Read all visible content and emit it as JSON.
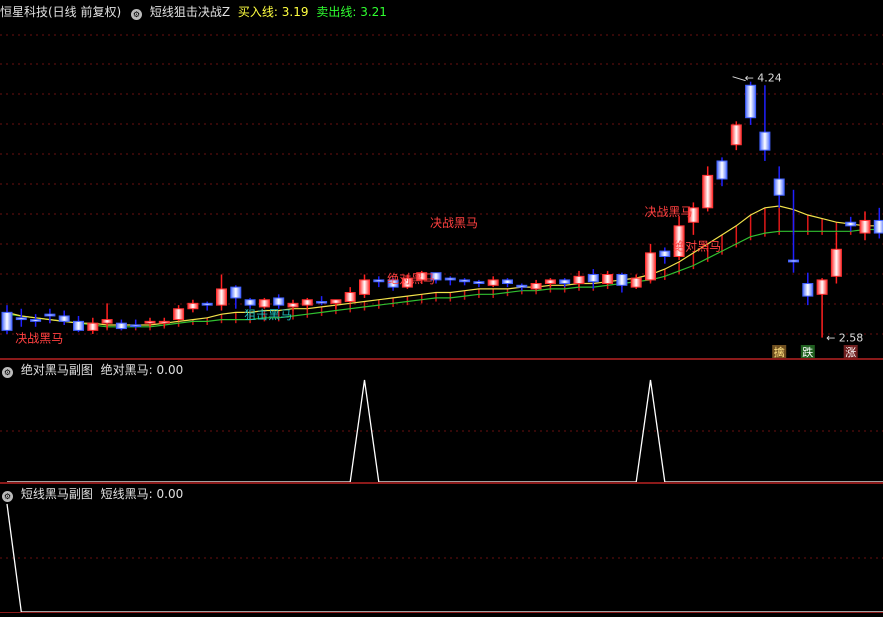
{
  "main_header": {
    "stock_name": "恒星科技(日线 前复权)",
    "indicator": "短线狙击决战Z",
    "buy_label": "买入线:",
    "buy_value": "3.19",
    "sell_label": "卖出线:",
    "sell_value": "3.21",
    "colors": {
      "buy": "#ffff40",
      "sell": "#30ff30"
    }
  },
  "sub1_header": {
    "title": "绝对黑马副图",
    "series_label": "绝对黑马:",
    "series_value": "0.00"
  },
  "sub2_header": {
    "title": "短线黑马副图",
    "series_label": "短线黑马:",
    "series_value": "0.00"
  },
  "icons": [
    "gear-icon"
  ],
  "chart_data": [
    {
      "type": "candlestick",
      "price_range": [
        2.5,
        4.32
      ],
      "high_label": "4.24",
      "low_label": "2.58",
      "candles": [
        [
          2.72,
          2.62,
          2.6,
          2.76,
          "down"
        ],
        [
          2.68,
          2.69,
          2.64,
          2.74,
          "down"
        ],
        [
          2.68,
          2.67,
          2.64,
          2.71,
          "down"
        ],
        [
          2.7,
          2.71,
          2.66,
          2.74,
          "down"
        ],
        [
          2.7,
          2.67,
          2.65,
          2.73,
          "down"
        ],
        [
          2.67,
          2.62,
          2.61,
          2.7,
          "down"
        ],
        [
          2.62,
          2.66,
          2.6,
          2.69,
          "up"
        ],
        [
          2.68,
          2.66,
          2.63,
          2.77,
          "up"
        ],
        [
          2.66,
          2.63,
          2.62,
          2.68,
          "down"
        ],
        [
          2.65,
          2.65,
          2.63,
          2.68,
          "down"
        ],
        [
          2.66,
          2.67,
          2.64,
          2.69,
          "up"
        ],
        [
          2.66,
          2.67,
          2.64,
          2.69,
          "up"
        ],
        [
          2.68,
          2.74,
          2.67,
          2.76,
          "up"
        ],
        [
          2.74,
          2.77,
          2.72,
          2.79,
          "up"
        ],
        [
          2.77,
          2.76,
          2.73,
          2.78,
          "down"
        ],
        [
          2.76,
          2.85,
          2.73,
          2.93,
          "up"
        ],
        [
          2.86,
          2.8,
          2.74,
          2.87,
          "down"
        ],
        [
          2.79,
          2.76,
          2.74,
          2.8,
          "down"
        ],
        [
          2.75,
          2.79,
          2.74,
          2.8,
          "up"
        ],
        [
          2.8,
          2.76,
          2.74,
          2.82,
          "down"
        ],
        [
          2.75,
          2.77,
          2.73,
          2.79,
          "up"
        ],
        [
          2.76,
          2.79,
          2.74,
          2.8,
          "up"
        ],
        [
          2.78,
          2.78,
          2.76,
          2.81,
          "down"
        ],
        [
          2.77,
          2.79,
          2.74,
          2.79,
          "up"
        ],
        [
          2.78,
          2.83,
          2.77,
          2.86,
          "up"
        ],
        [
          2.82,
          2.9,
          2.8,
          2.93,
          "up"
        ],
        [
          2.9,
          2.89,
          2.86,
          2.92,
          "down"
        ],
        [
          2.9,
          2.86,
          2.84,
          2.91,
          "down"
        ],
        [
          2.86,
          2.91,
          2.85,
          2.93,
          "up"
        ],
        [
          2.9,
          2.94,
          2.88,
          2.95,
          "up"
        ],
        [
          2.94,
          2.9,
          2.88,
          2.94,
          "down"
        ],
        [
          2.91,
          2.9,
          2.87,
          2.92,
          "down"
        ],
        [
          2.9,
          2.89,
          2.87,
          2.91,
          "down"
        ],
        [
          2.89,
          2.88,
          2.86,
          2.9,
          "down"
        ],
        [
          2.87,
          2.9,
          2.86,
          2.92,
          "up"
        ],
        [
          2.9,
          2.88,
          2.86,
          2.91,
          "down"
        ],
        [
          2.87,
          2.86,
          2.84,
          2.88,
          "down"
        ],
        [
          2.85,
          2.88,
          2.84,
          2.9,
          "up"
        ],
        [
          2.88,
          2.9,
          2.86,
          2.91,
          "up"
        ],
        [
          2.9,
          2.88,
          2.86,
          2.91,
          "down"
        ],
        [
          2.88,
          2.92,
          2.86,
          2.95,
          "up"
        ],
        [
          2.93,
          2.89,
          2.85,
          2.96,
          "down"
        ],
        [
          2.88,
          2.93,
          2.87,
          2.95,
          "up"
        ],
        [
          2.93,
          2.87,
          2.83,
          2.94,
          "down"
        ],
        [
          2.86,
          2.91,
          2.85,
          2.93,
          "up"
        ],
        [
          2.9,
          3.05,
          2.89,
          3.1,
          "up"
        ],
        [
          3.06,
          3.03,
          2.99,
          3.08,
          "down"
        ],
        [
          3.03,
          3.2,
          3.01,
          3.25,
          "up"
        ],
        [
          3.22,
          3.3,
          3.15,
          3.33,
          "up"
        ],
        [
          3.3,
          3.48,
          3.28,
          3.53,
          "up"
        ],
        [
          3.56,
          3.46,
          3.42,
          3.58,
          "down"
        ],
        [
          3.65,
          3.76,
          3.62,
          3.78,
          "up"
        ],
        [
          3.98,
          3.8,
          3.76,
          4.0,
          "down"
        ],
        [
          3.72,
          3.62,
          3.56,
          3.98,
          "down"
        ],
        [
          3.46,
          3.37,
          3.3,
          3.53,
          "down"
        ],
        [
          3.0,
          3.01,
          2.94,
          3.4,
          "down"
        ],
        [
          2.88,
          2.81,
          2.76,
          2.94,
          "down"
        ],
        [
          2.82,
          2.9,
          2.58,
          2.91,
          "up"
        ],
        [
          2.92,
          3.07,
          2.88,
          3.16,
          "up"
        ],
        [
          3.22,
          3.2,
          3.17,
          3.25,
          "down"
        ],
        [
          3.16,
          3.23,
          3.12,
          3.28,
          "up"
        ],
        [
          3.23,
          3.16,
          3.13,
          3.3,
          "down"
        ],
        [
          3.22,
          3.13,
          3.08,
          3.22,
          "down"
        ]
      ],
      "ma_line": [
        2.72,
        2.7,
        2.69,
        2.68,
        2.67,
        2.66,
        2.66,
        2.65,
        2.65,
        2.65,
        2.65,
        2.66,
        2.67,
        2.68,
        2.69,
        2.71,
        2.72,
        2.72,
        2.73,
        2.73,
        2.74,
        2.74,
        2.75,
        2.76,
        2.77,
        2.78,
        2.79,
        2.8,
        2.81,
        2.82,
        2.83,
        2.83,
        2.84,
        2.85,
        2.85,
        2.85,
        2.86,
        2.86,
        2.87,
        2.87,
        2.88,
        2.88,
        2.89,
        2.9,
        2.91,
        2.93,
        2.96,
        3.0,
        3.05,
        3.1,
        3.15,
        3.2,
        3.26,
        3.3,
        3.31,
        3.29,
        3.26,
        3.24,
        3.22,
        3.21,
        3.2,
        3.2,
        3.18
      ],
      "support_line": [
        2.71,
        2.7,
        2.69,
        2.68,
        2.67,
        2.66,
        2.65,
        2.64,
        2.64,
        2.64,
        2.64,
        2.65,
        2.66,
        2.67,
        2.67,
        2.68,
        2.68,
        2.68,
        2.69,
        2.69,
        2.7,
        2.71,
        2.72,
        2.73,
        2.74,
        2.75,
        2.76,
        2.77,
        2.78,
        2.79,
        2.8,
        2.8,
        2.81,
        2.82,
        2.82,
        2.83,
        2.84,
        2.84,
        2.85,
        2.85,
        2.86,
        2.86,
        2.87,
        2.88,
        2.89,
        2.9,
        2.92,
        2.95,
        2.98,
        3.02,
        3.06,
        3.1,
        3.14,
        3.16,
        3.17,
        3.17,
        3.17,
        3.17,
        3.17,
        3.17,
        3.18,
        3.18,
        3.17
      ],
      "colors": {
        "up": "#ff2020",
        "down": "#4a6cff",
        "ma": "#f2e24a",
        "support": "#30c030"
      },
      "annotations": [
        {
          "text": "决战黑马",
          "color": "#ff4040",
          "i": 1,
          "price": 2.62
        },
        {
          "text": "狙击黑马",
          "color": "#20c0c0",
          "i": 17,
          "price": 2.75
        },
        {
          "text": "绝对黑马",
          "color": "#ff4040",
          "i": 27,
          "price": 2.95
        },
        {
          "text": "决战黑马",
          "color": "#ff4040",
          "i": 30,
          "price": 3.26
        },
        {
          "text": "决战黑马",
          "color": "#ff4040",
          "i": 45,
          "price": 3.32
        },
        {
          "text": "绝对黑马",
          "color": "#ff4040",
          "i": 47,
          "price": 3.13
        }
      ],
      "markers": [
        {
          "text": "擒",
          "i": 54,
          "bg": "#705020",
          "color": "#ffe080"
        },
        {
          "text": "跌",
          "i": 56,
          "bg": "#206020",
          "color": "#ffffff"
        },
        {
          "text": "涨",
          "i": 59,
          "bg": "#702020",
          "color": "#ffffff"
        }
      ]
    },
    {
      "type": "line",
      "series": [
        {
          "values": [
            0,
            0,
            0,
            0,
            0,
            0,
            0,
            0,
            0,
            0,
            0,
            0,
            0,
            0,
            0,
            0,
            0,
            0,
            0,
            0,
            0,
            0,
            0,
            0,
            0,
            1,
            0,
            0,
            0,
            0,
            0,
            0,
            0,
            0,
            0,
            0,
            0,
            0,
            0,
            0,
            0,
            0,
            0,
            0,
            0,
            1,
            0,
            0,
            0,
            0,
            0,
            0,
            0,
            0,
            0,
            0,
            0,
            0,
            0,
            0,
            0,
            0,
            0
          ]
        }
      ],
      "ylim": [
        0,
        1
      ]
    },
    {
      "type": "line",
      "series": [
        {
          "values": [
            1,
            0,
            0,
            0,
            0,
            0,
            0,
            0,
            0,
            0,
            0,
            0,
            0,
            0,
            0,
            0,
            0,
            0,
            0,
            0,
            0,
            0,
            0,
            0,
            0,
            0,
            0,
            0,
            0,
            0,
            0,
            0,
            0,
            0,
            0,
            0,
            0,
            0,
            0,
            0,
            0,
            0,
            0,
            0,
            0,
            0,
            0,
            0,
            0,
            0,
            0,
            0,
            0,
            0,
            0,
            0,
            0,
            0,
            0,
            0,
            0,
            0,
            0
          ]
        }
      ],
      "ylim": [
        0,
        1
      ]
    }
  ]
}
